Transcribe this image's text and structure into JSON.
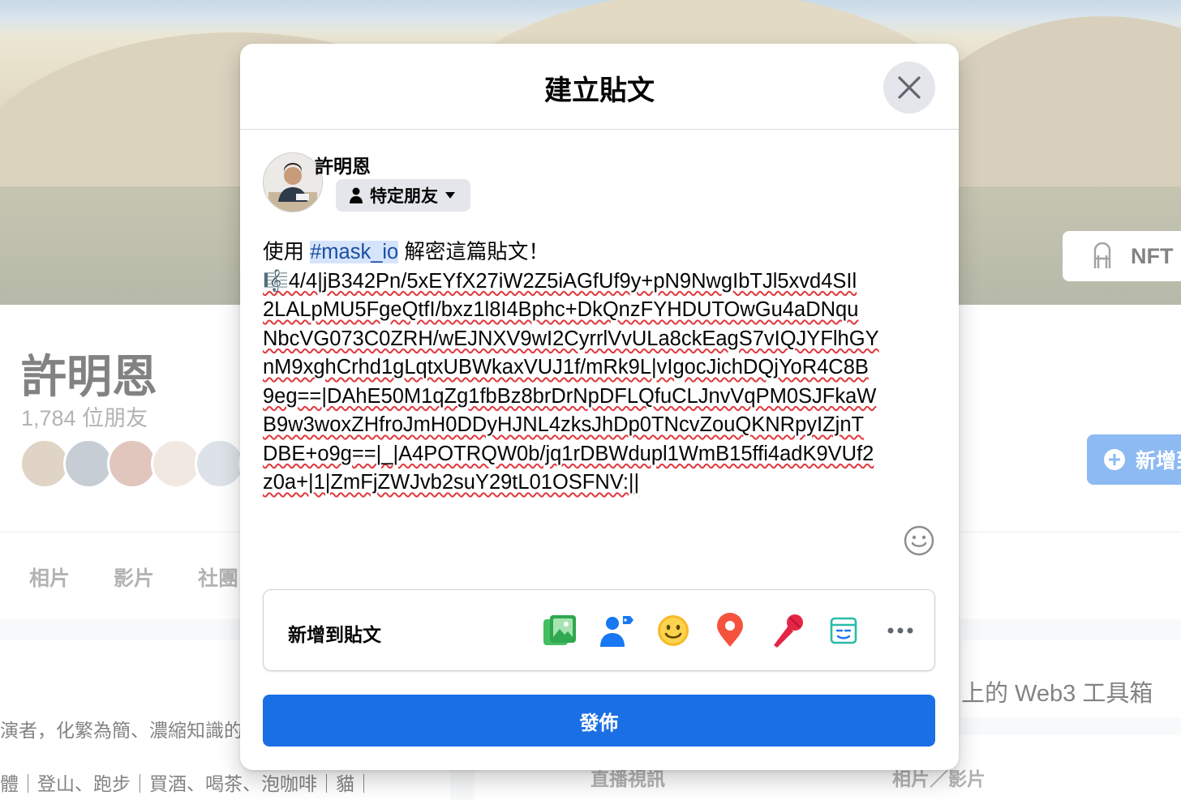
{
  "background": {
    "nft_button_label": "NFT",
    "profile_name": "許明恩",
    "friends_count": "1,784 位朋友",
    "add_story_label": "新增到",
    "tabs": [
      "相片",
      "影片",
      "社團"
    ],
    "intro_line1": "演者，化繁為簡、濃縮知識的",
    "intro_line2": "體｜登山、跑步｜買酒、喝茶、泡咖啡｜貓｜",
    "web3_text": "上的 Web3 工具箱",
    "live_video_label": "直播視訊",
    "photo_video_label": "相片／影片"
  },
  "modal": {
    "title": "建立貼文",
    "user_name": "許明恩",
    "audience_label": "特定朋友",
    "post_text": {
      "prefix": "使用 ",
      "hashtag": "#mask_io",
      "suffix": " 解密這篇貼文！",
      "lines": [
        "🎼4/4|jB342Pn/5xEYfX27iW2Z5iAGfUf9y+pN9NwgIbTJl5xvd4SIl",
        "2LALpMU5FgeQtfI/bxz1l8I4Bphc+DkQnzFYHDUTOwGu4aDNqu",
        "NbcVG073C0ZRH/wEJNXV9wI2CyrrlVvULa8ckEagS7vIQJYFlhGY",
        "nM9xghCrhd1gLqtxUBWkaxVUJ1f/mRk9L|vIgocJichDQjYoR4C8B",
        "9eg==|DAhE50M1qZg1fbBz8brDrNpDFLQfuCLJnvVqPM0SJFkaW",
        "B9w3woxZHfroJmH0DDyHJNL4zksJhDp0TNcvZouQKNRpyIZjnT",
        "DBE+o9g==|_|A4POTRQW0b/jq1rDBWdupl1WmB15ffi4adK9VUf2",
        "z0a+|1|ZmFjZWJvb2suY29tL01OSFNV:||"
      ]
    },
    "add_to_post_label": "新增到貼文",
    "add_icons": [
      "photo-icon",
      "tag-people-icon",
      "feeling-icon",
      "location-icon",
      "mic-icon",
      "gif-icon",
      "more-icon"
    ],
    "publish_label": "發佈"
  }
}
